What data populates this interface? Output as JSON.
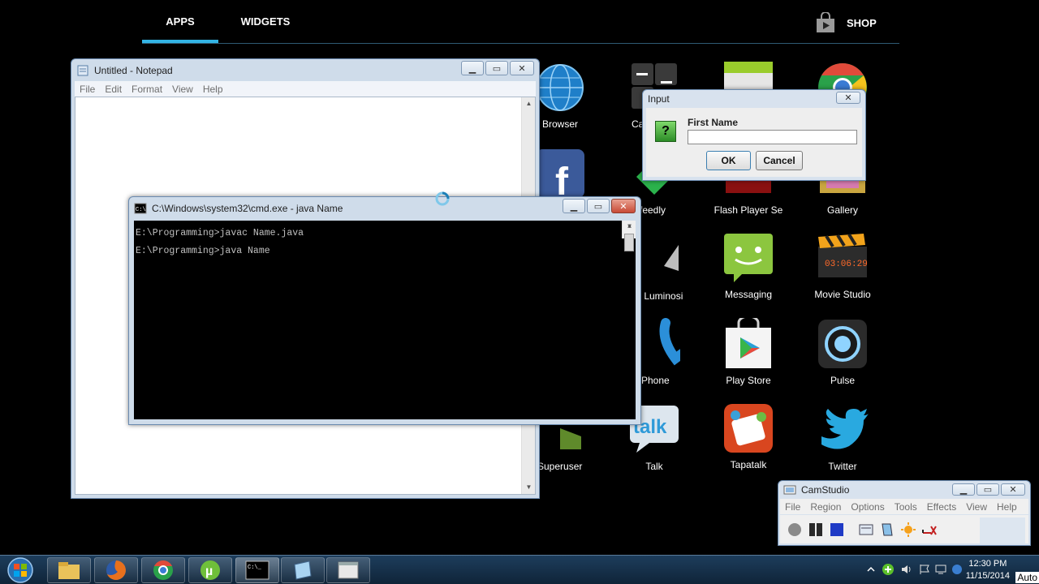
{
  "launcher": {
    "tabs": {
      "apps": "APPS",
      "widgets": "WIDGETS"
    },
    "shop_label": "SHOP",
    "accent": "#33b5e5",
    "apps": [
      {
        "label": "Browser",
        "icon": "globe-icon"
      },
      {
        "label": "Ca",
        "icon": "calculator-icon"
      },
      {
        "label": "",
        "icon": "calendar-icon"
      },
      {
        "label": "",
        "icon": "chrome-icon"
      },
      {
        "label": "",
        "icon": "facebook-icon"
      },
      {
        "label": "feedly",
        "icon": "feedly-icon"
      },
      {
        "label": "Flash Player Se",
        "icon": "flash-icon"
      },
      {
        "label": "Gallery",
        "icon": "gallery-icon"
      },
      {
        "label": "s Luminosi",
        "icon": "luminosity-icon"
      },
      {
        "label": "Messaging",
        "icon": "messaging-icon"
      },
      {
        "label": "Movie Studio",
        "icon": "clapperboard-icon"
      },
      {
        "label": "Phone",
        "icon": "phone-icon"
      },
      {
        "label": "Play Store",
        "icon": "play-store-icon"
      },
      {
        "label": "Pulse",
        "icon": "pulse-icon"
      },
      {
        "label": "Superuser",
        "icon": "superuser-icon"
      },
      {
        "label": "Talk",
        "icon": "talk-icon"
      },
      {
        "label": "Tapatalk",
        "icon": "tapatalk-icon"
      },
      {
        "label": "Twitter",
        "icon": "twitter-icon"
      }
    ]
  },
  "notepad": {
    "title": "Untitled - Notepad",
    "menu": [
      "File",
      "Edit",
      "Format",
      "View",
      "Help"
    ]
  },
  "cmd": {
    "title": "C:\\Windows\\system32\\cmd.exe - java  Name",
    "lines": [
      "E:\\Programming>javac Name.java",
      "E:\\Programming>java Name"
    ]
  },
  "input_dialog": {
    "title": "Input",
    "label": "First Name",
    "value": "",
    "ok": "OK",
    "cancel": "Cancel"
  },
  "camstudio": {
    "title": "CamStudio",
    "menu": [
      "File",
      "Region",
      "Options",
      "Tools",
      "Effects",
      "View",
      "Help"
    ]
  },
  "taskbar": {
    "time": "12:30 PM",
    "date": "11/15/2014",
    "overflow_text": "Auto",
    "pinned": [
      "explorer-icon",
      "firefox-icon",
      "chrome-icon",
      "utorrent-icon",
      "cmd-icon",
      "notepad-icon",
      "window-icon"
    ]
  }
}
